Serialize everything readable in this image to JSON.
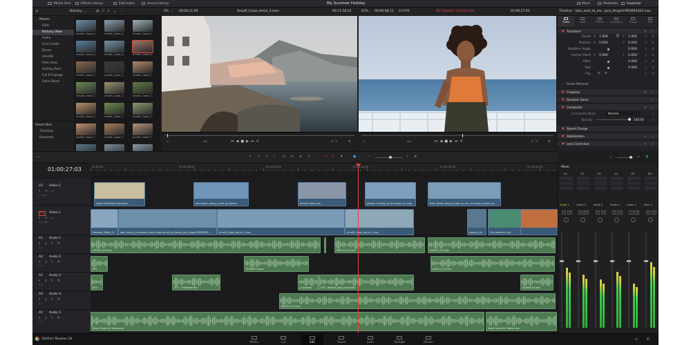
{
  "topbar": {
    "media_pool": "Media Pool",
    "effects_library": "Effects Library",
    "edit_index": "Edit Index",
    "sound_library": "Sound Library",
    "project_title": "My Summer Holiday",
    "mixer": "Mixer",
    "metadata": "Metadata",
    "inspector": "Inspector"
  },
  "bar2": {
    "bin_name": "Balcony ...",
    "zoom_left": "0%",
    "tc_left": "00:00:11:00",
    "clip_name": "Amalfi_Coast_Aerial_3.mov",
    "tc_source": "00:11:58:12",
    "zoom_right": "63%",
    "tc_record": "00:00:08:11",
    "fps": "23.976",
    "timeline_name": "My Summer Holiday Edit",
    "tc_timeline": "01:00:27:03",
    "inspector_clip": "Timeline - take_next_to_mo...Jack_Amgrid-PRORES422.mov"
  },
  "leftnav": {
    "master": "Master",
    "items": [
      "Edits",
      "Balcony View",
      "Audio",
      "End Credits",
      "Drone",
      "Amalfie",
      "Interviews",
      "Holiday Reel",
      "Full 8 Footage",
      "Extra Shoot"
    ],
    "selected": "Balcony View",
    "smart_bins": "Smart Bins",
    "smart_items": [
      "Timelines",
      "Keywords"
    ]
  },
  "thumbs": [
    {
      "label": "Amalfi_Coast_A...",
      "color": "#6f8fa8"
    },
    {
      "label": "Amalfi_Coast_A...",
      "color": "#8aa0b0"
    },
    {
      "label": "Amalfi_Coast_A...",
      "color": "#9eb0b8"
    },
    {
      "label": "Amalfi_Coast_A...",
      "color": "#5a7f9a"
    },
    {
      "label": "Amalfi_Coast_A...",
      "color": "#7893a6"
    },
    {
      "label": "Amalfi_Coast_A...",
      "color": "#a07868"
    },
    {
      "label": "Amalfi_Coast_T...",
      "color": "#8a6a50"
    },
    {
      "label": "Amalfi_Coast_T...",
      "color": "#3f3a36"
    },
    {
      "label": "Amalfi_Coast_T...",
      "color": "#b08a6a"
    },
    {
      "label": "Amalfi_Coast_T...",
      "color": "#6e8a58"
    },
    {
      "label": "Amalfi_Coast_T...",
      "color": "#9a9070"
    },
    {
      "label": "Amalfi_Coast_T...",
      "color": "#5e7a48"
    },
    {
      "label": "Amalfi_Coast_T...",
      "color": "#b8906a"
    },
    {
      "label": "Amalfi_Coast_T...",
      "color": "#6a8a50"
    },
    {
      "label": "Amalfi_Coast_T...",
      "color": "#8a9a70"
    },
    {
      "label": "Amalfi_Coast_T...",
      "color": "#c09070"
    },
    {
      "label": "Amalfi_Coast_T...",
      "color": "#a8805a"
    },
    {
      "label": "Amalfi_Coast_T...",
      "color": "#b89478"
    },
    {
      "label": "Redhorn_Land...",
      "color": "#5a7888"
    },
    {
      "label": "Redhorn_Land...",
      "color": "#7a8e98"
    },
    {
      "label": "Redhorn_Land...",
      "color": "#8a9aa8"
    },
    {
      "label": "",
      "color": "#6a5a50"
    },
    {
      "label": "",
      "color": "#8a6a58"
    },
    {
      "label": "",
      "color": "#7a6a60"
    }
  ],
  "inspector": {
    "tabs": [
      "Video",
      "Audio",
      "Effects",
      "Transition",
      "Image",
      "File"
    ],
    "transform": "Transform",
    "rows": [
      {
        "label": "Zoom",
        "x_label": "X",
        "x": "1.000",
        "y_label": "Y",
        "y": "1.000"
      },
      {
        "label": "Position",
        "x_label": "X",
        "x": "0.000",
        "y_label": "Y",
        "y": "0.000"
      },
      {
        "label": "Rotation Angle",
        "x_label": "",
        "x": "",
        "y_label": "",
        "y": "0.000"
      },
      {
        "label": "Anchor Point",
        "x_label": "X",
        "x": "0.000",
        "y_label": "Y",
        "y": "0.000"
      },
      {
        "label": "Pitch",
        "x_label": "",
        "x": "",
        "y_label": "",
        "y": "0.000"
      },
      {
        "label": "Yaw",
        "x_label": "",
        "x": "",
        "y_label": "",
        "y": "0.000"
      },
      {
        "label": "Flip",
        "x_label": "",
        "x": "",
        "y_label": "",
        "y": ""
      }
    ],
    "smart_reframe": "Smart Reframe",
    "cropping": "Cropping",
    "dynamic_zoom": "Dynamic Zoom",
    "composite": "Composite",
    "composite_mode_label": "Composite Mode",
    "composite_mode": "Normal",
    "opacity_label": "Opacity",
    "opacity": "100.00",
    "speed_change": "Speed Change",
    "stabilization": "Stabilization",
    "lens_correction": "Lens Correction"
  },
  "timeline": {
    "timecode": "01:00:27:03",
    "ruler": [
      "01:00:00",
      "01:00:08:00",
      "01:00:16:00",
      "01:00:24:00",
      "01:00:32:00",
      "01:00:40:00"
    ],
    "tracks": [
      {
        "id": "V2",
        "name": "Video 2",
        "clips_label": "3 Clips"
      },
      {
        "id": "V1",
        "name": "Video 1",
        "clips_label": "14 Clips"
      },
      {
        "id": "A1",
        "name": "Audio 1",
        "clips_label": "2.0"
      },
      {
        "id": "A2",
        "name": "Audio 2",
        "clips_label": "2.0"
      },
      {
        "id": "A3",
        "name": "Audio 3",
        "clips_label": "2.0"
      },
      {
        "id": "A4",
        "name": "Audio 4",
        "clips_label": "2.0"
      },
      {
        "id": "A5",
        "name": "Audio 5",
        "clips_label": "2.0"
      }
    ],
    "v2_clips": [
      "Super Old Simple transition",
      "mountains_along_a_lake_by_Roma...",
      "Amalfi_Coast_Aer...",
      "people_running_on_the_beach_in_kng...",
      "thick_forest_along_a_lake_by_the_mountains_aerial_by..."
    ],
    "v1_clips": [
      "Redbook_Talent_3...",
      "take_next_to_mountains_and_trees_aerial_by_Roma_Jack_Amgrid-PRORES4...",
      "Amalfi_Coast_Aerial_3.mov",
      "Amalfi_Coast_Aerial_3.mov",
      "woman_rid...",
      "Clip Absence ring..."
    ],
    "a1_clips": [
      "A00152_01.mov",
      "A00152_01.mov",
      "A00152_01.mov",
      "A00152_01.mov"
    ],
    "a2_clips": [
      "SFX -",
      "SOUND FX.wav",
      "A00113_01.mov"
    ],
    "a3_clips": [
      "SFX -",
      "SFX - Overhead.wav",
      "Crossfade",
      "SFX - Distant_prop_plane.wav",
      "SOUND FX.wav"
    ],
    "a4_clips": [
      "A00113_01.mov"
    ],
    "a5_clips": [
      "Music Score for Trailer.mov",
      "Music Score for Trailer.mov"
    ]
  },
  "mixer": {
    "title": "Mixer",
    "channels": [
      "A1",
      "A2",
      "A3",
      "A4",
      "A5",
      "M1"
    ],
    "tracks": [
      "Audio 1",
      "Audio 2",
      "Audio 3",
      "Audio 4",
      "Audio 5",
      "Main 1"
    ],
    "levels": [
      0.62,
      0.55,
      0.5,
      0.58,
      0.46,
      0.68
    ]
  },
  "bottom": {
    "app_name": "DaVinci Resolve 18",
    "pages": [
      "Media",
      "Cut",
      "Edit",
      "Fusion",
      "Color",
      "Fairlight",
      "Deliver"
    ],
    "active_page": "Edit"
  },
  "colors": {
    "accent_red": "#e0483e",
    "audio_clip": "#4e7a52",
    "video_clip": "#3a5a78",
    "meter_green": "#3fd04a"
  }
}
